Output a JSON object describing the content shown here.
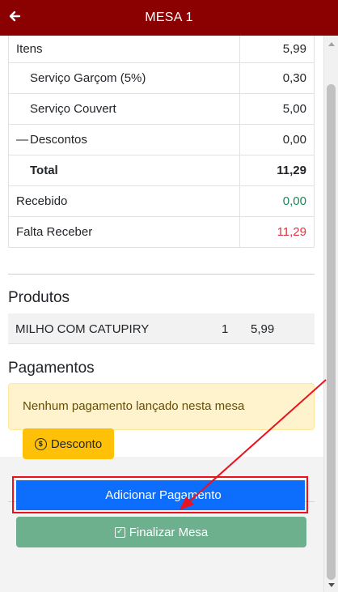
{
  "header": {
    "title": "MESA 1",
    "back_icon": "arrow-left-icon"
  },
  "summary": {
    "rows": [
      {
        "icon": "",
        "label": "Itens",
        "value": "5,99"
      },
      {
        "icon": "",
        "label": "Serviço Garçom (5%)",
        "value": "0,30"
      },
      {
        "icon": "",
        "label": "Serviço Couvert",
        "value": "5,00"
      },
      {
        "icon": "—",
        "label": "Descontos",
        "value": "0,00"
      },
      {
        "icon": "",
        "label": "Total",
        "value": "11,29"
      },
      {
        "icon": "",
        "label": "Recebido",
        "value": "0,00"
      },
      {
        "icon": "",
        "label": "Falta Receber",
        "value": "11,29"
      }
    ]
  },
  "produtos": {
    "title": "Produtos",
    "items": [
      {
        "name": "MILHO COM CATUPIRY",
        "qty": "1",
        "price": "5,99"
      }
    ]
  },
  "pagamentos": {
    "title": "Pagamentos",
    "empty_message": "Nenhum pagamento lançado nesta mesa"
  },
  "actions": {
    "desconto_label": "Desconto",
    "adicionar_icon": "",
    "adicionar_label": "Adicionar Pagamento",
    "finalizar_label": "Finalizar Mesa"
  },
  "colors": {
    "header": "#8b0000",
    "primary": "#0d6efd",
    "warning": "#ffc107",
    "success_muted": "#6cb08d",
    "received": "#198754",
    "pending": "#dc3545",
    "annotation": "#e8131f"
  }
}
